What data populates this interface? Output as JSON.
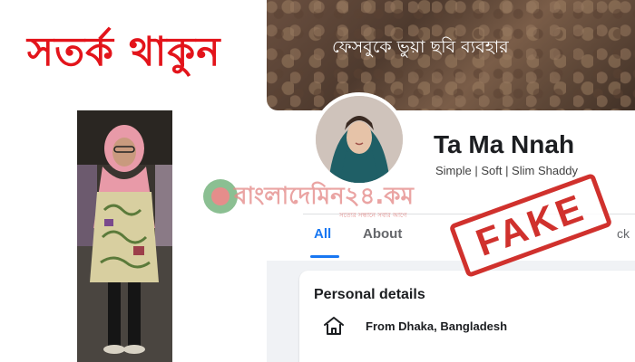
{
  "warning": {
    "title": "সতর্ক থাকুন",
    "color": "#e3141b"
  },
  "cover": {
    "caption": "ফেসবুকে ভুয়া ছবি ব্যবহার"
  },
  "profile": {
    "name": "Ta Ma Nnah",
    "bio": "Simple | Soft | Slim Shaddy",
    "tabs": [
      {
        "label": "All",
        "active": true
      },
      {
        "label": "About",
        "active": false
      },
      {
        "label": "ck",
        "active": false
      }
    ],
    "accent_color": "#1877f2"
  },
  "personal_details": {
    "title": "Personal details",
    "location": "From Dhaka, Bangladesh",
    "location_icon": "home-icon"
  },
  "stamp": {
    "text": "FAKE",
    "color": "#d0312d"
  },
  "watermark": {
    "text": "বাংলাদেমিন২৪.কম",
    "tagline": "সত্যের সন্ধানে সবার আগে"
  }
}
